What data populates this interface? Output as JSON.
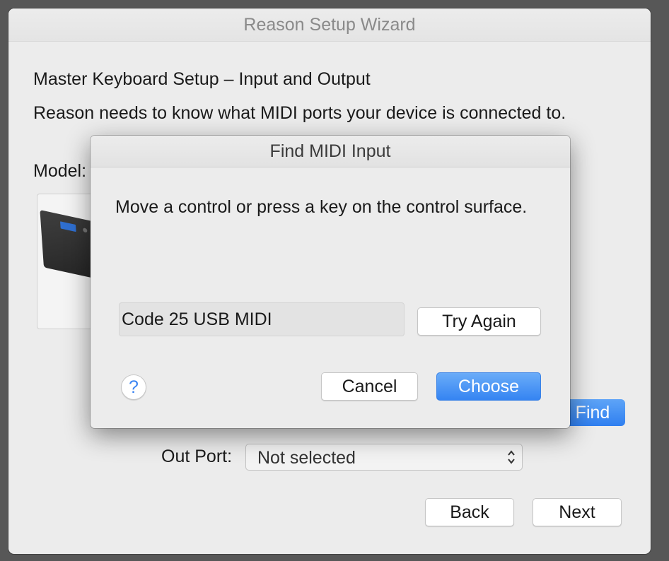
{
  "window": {
    "title": "Reason Setup Wizard",
    "heading": "Master Keyboard Setup – Input and Output",
    "description": "Reason needs to know what MIDI ports your device is connected to.",
    "model_label": "Model:",
    "find_label": "Find",
    "out_port": {
      "label": "Out Port:",
      "value": "Not selected"
    },
    "back_label": "Back",
    "next_label": "Next"
  },
  "dialog": {
    "title": "Find MIDI Input",
    "message": "Move a control or press a key on the control surface.",
    "detected_port": "Code 25 USB MIDI",
    "try_again_label": "Try Again",
    "help_label": "?",
    "cancel_label": "Cancel",
    "choose_label": "Choose"
  },
  "colors": {
    "accent": "#3584f2",
    "window_bg": "#ececec",
    "backdrop": "#575757"
  }
}
